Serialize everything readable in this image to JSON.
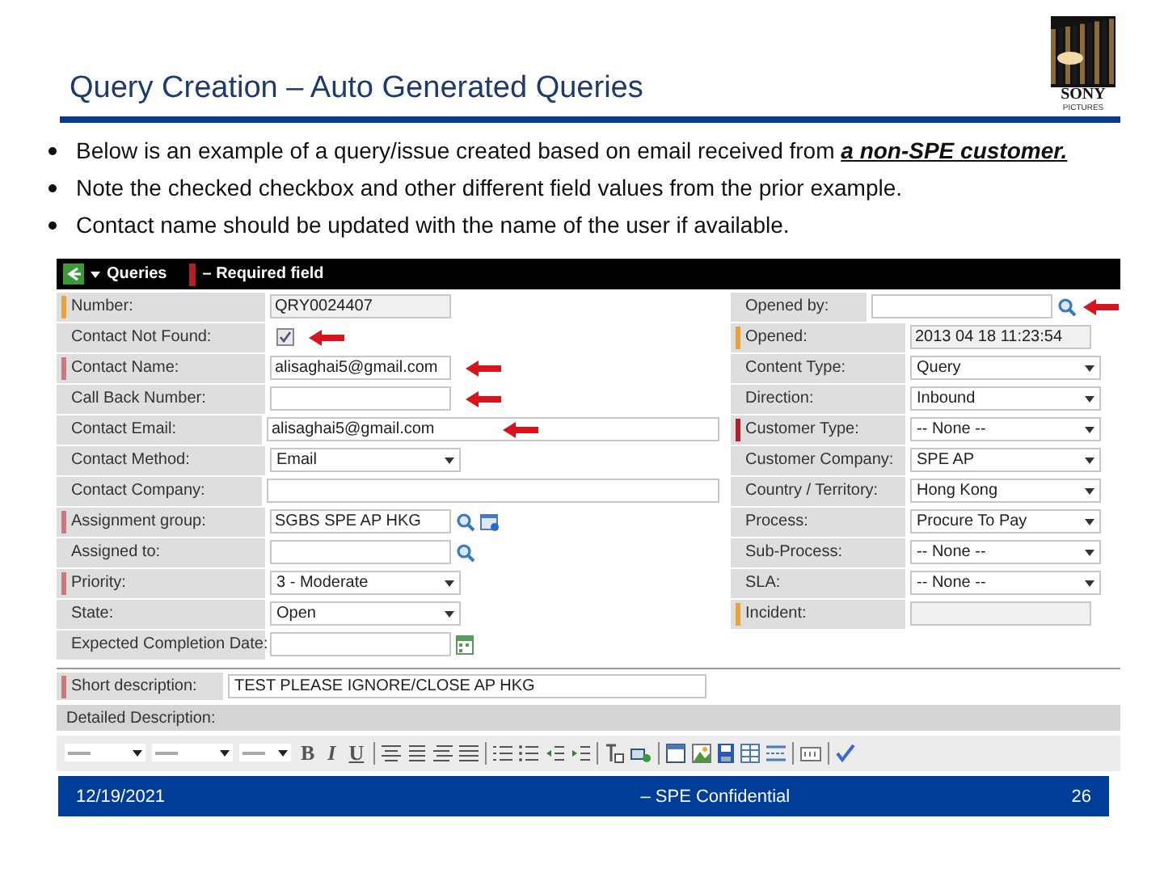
{
  "slide": {
    "title": "Query Creation – Auto Generated Queries",
    "logo": {
      "name": "SONY",
      "sub": "PICTURES"
    },
    "bullets": [
      "Below is an example of a query/issue created based on email received from **a non-SPE customer.**",
      "Note the checked checkbox and  other different field values from the prior example.",
      "Contact name should be updated with the name of the user if available."
    ]
  },
  "form": {
    "header": {
      "title": "Queries",
      "legend": "– Required field",
      "color": "#b0202a"
    },
    "left_rows": [
      {
        "label": "Number:",
        "color": "#e8a33d",
        "kind": "readonly",
        "value": "QRY0024407"
      },
      {
        "label": "Contact Not Found:",
        "kind": "checkbox",
        "checked": true,
        "arrow": true
      },
      {
        "label": "Contact Name:",
        "color": "#c77a80",
        "kind": "text",
        "value": "alisaghai5@gmail.com",
        "arrow": true
      },
      {
        "label": "Call Back Number:",
        "kind": "text",
        "arrow": true
      },
      {
        "label": "Contact Email:",
        "kind": "wide",
        "value": "alisaghai5@gmail.com",
        "arrow": true
      },
      {
        "label": "Contact Method:",
        "kind": "select",
        "value": "Email"
      },
      {
        "label": "Contact Company:",
        "kind": "wide"
      },
      {
        "label": "Assignment group:",
        "color": "#c77a80",
        "kind": "lookup_ref",
        "value": "SGBS SPE AP HKG"
      },
      {
        "label": "Assigned to:",
        "kind": "lookup"
      },
      {
        "label": "Priority:",
        "color": "#c77a80",
        "kind": "select",
        "value": "3 - Moderate"
      },
      {
        "label": "State:",
        "kind": "select",
        "value": "Open"
      },
      {
        "label": "Expected Completion Date:",
        "kind": "date"
      }
    ],
    "right_rows": [
      {
        "label": "Opened by:",
        "kind": "lookup",
        "arrow": true
      },
      {
        "label": "Opened:",
        "color": "#e8a33d",
        "kind": "readonly",
        "value": "2013 04 18 11:23:54"
      },
      {
        "label": "Content Type:",
        "kind": "select",
        "value": "Query"
      },
      {
        "label": "Direction:",
        "kind": "select",
        "value": "Inbound"
      },
      {
        "label": "Customer Type:",
        "color": "#b0202a",
        "kind": "select",
        "value": "-- None --"
      },
      {
        "label": "Customer Company:",
        "kind": "select",
        "value": "SPE AP"
      },
      {
        "label": "Country / Territory:",
        "kind": "select",
        "value": "Hong Kong"
      },
      {
        "label": "Process:",
        "kind": "select",
        "value": "Procure To Pay"
      },
      {
        "label": "Sub-Process:",
        "kind": "select",
        "value": "-- None --"
      },
      {
        "label": "SLA:",
        "kind": "select",
        "value": "-- None --"
      },
      {
        "label": "Incident:",
        "color": "#e8a33d",
        "kind": "readonly"
      }
    ],
    "short_description": {
      "label": "Short description:",
      "color": "#c77a80",
      "value": "TEST PLEASE IGNORE/CLOSE AP HKG"
    },
    "detailed_description": {
      "label": "Detailed Description:"
    },
    "toolbar": {
      "format_buttons": [
        "B",
        "I",
        "U"
      ]
    }
  },
  "footer": {
    "date": "12/19/2021",
    "center": "– SPE Confidential",
    "page": "26"
  }
}
